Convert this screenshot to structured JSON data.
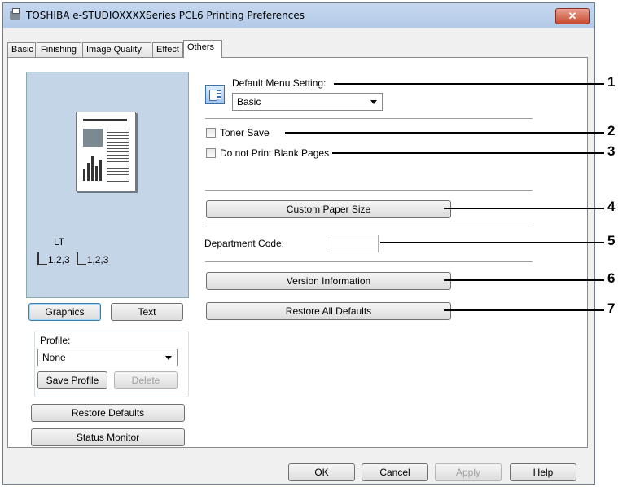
{
  "window": {
    "title": "TOSHIBA e-STUDIOXXXXSeries PCL6 Printing Preferences",
    "close_label": "✕"
  },
  "tabs": [
    "Basic",
    "Finishing",
    "Image Quality",
    "Effect",
    "Others"
  ],
  "active_tab": "Others",
  "preview": {
    "paper_size": "LT",
    "stack1": "1,2,3",
    "stack2": "1,2,3"
  },
  "left": {
    "graphics_button": "Graphics",
    "text_button": "Text",
    "profile_label": "Profile:",
    "profile_value": "None",
    "save_profile_button": "Save Profile",
    "delete_button": "Delete",
    "restore_defaults_button": "Restore Defaults",
    "status_monitor_button": "Status Monitor"
  },
  "main": {
    "default_menu_label": "Default Menu Setting:",
    "default_menu_value": "Basic",
    "toner_save_label": "Toner Save",
    "no_blank_pages_label": "Do not Print Blank Pages",
    "custom_paper_button": "Custom Paper Size",
    "department_code_label": "Department Code:",
    "department_code_value": "",
    "version_info_button": "Version Information",
    "restore_all_button": "Restore All Defaults"
  },
  "callouts": [
    "1",
    "2",
    "3",
    "4",
    "5",
    "6",
    "7"
  ],
  "footer": {
    "ok": "OK",
    "cancel": "Cancel",
    "apply": "Apply",
    "help": "Help"
  }
}
